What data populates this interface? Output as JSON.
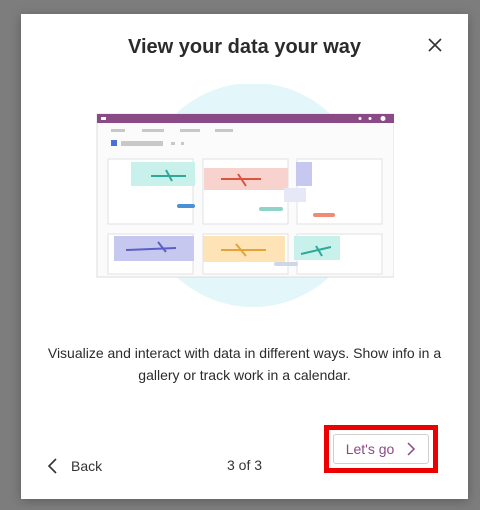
{
  "dialog": {
    "title": "View your data your way",
    "description": "Visualize and interact with data in different ways. Show info in a gallery or track work in a calendar.",
    "back_label": "Back",
    "pager": "3 of 3",
    "next_label": "Let's go"
  },
  "colors": {
    "accent": "#8a4a86",
    "titlebar": "#8a4a86",
    "circle": "#e3f6f9",
    "highlight": "#ec0000",
    "card_teal": "#c9f1ec",
    "card_red": "#f8d3cd",
    "card_purple": "#c7c8ef",
    "card_orange": "#fde3b6"
  }
}
